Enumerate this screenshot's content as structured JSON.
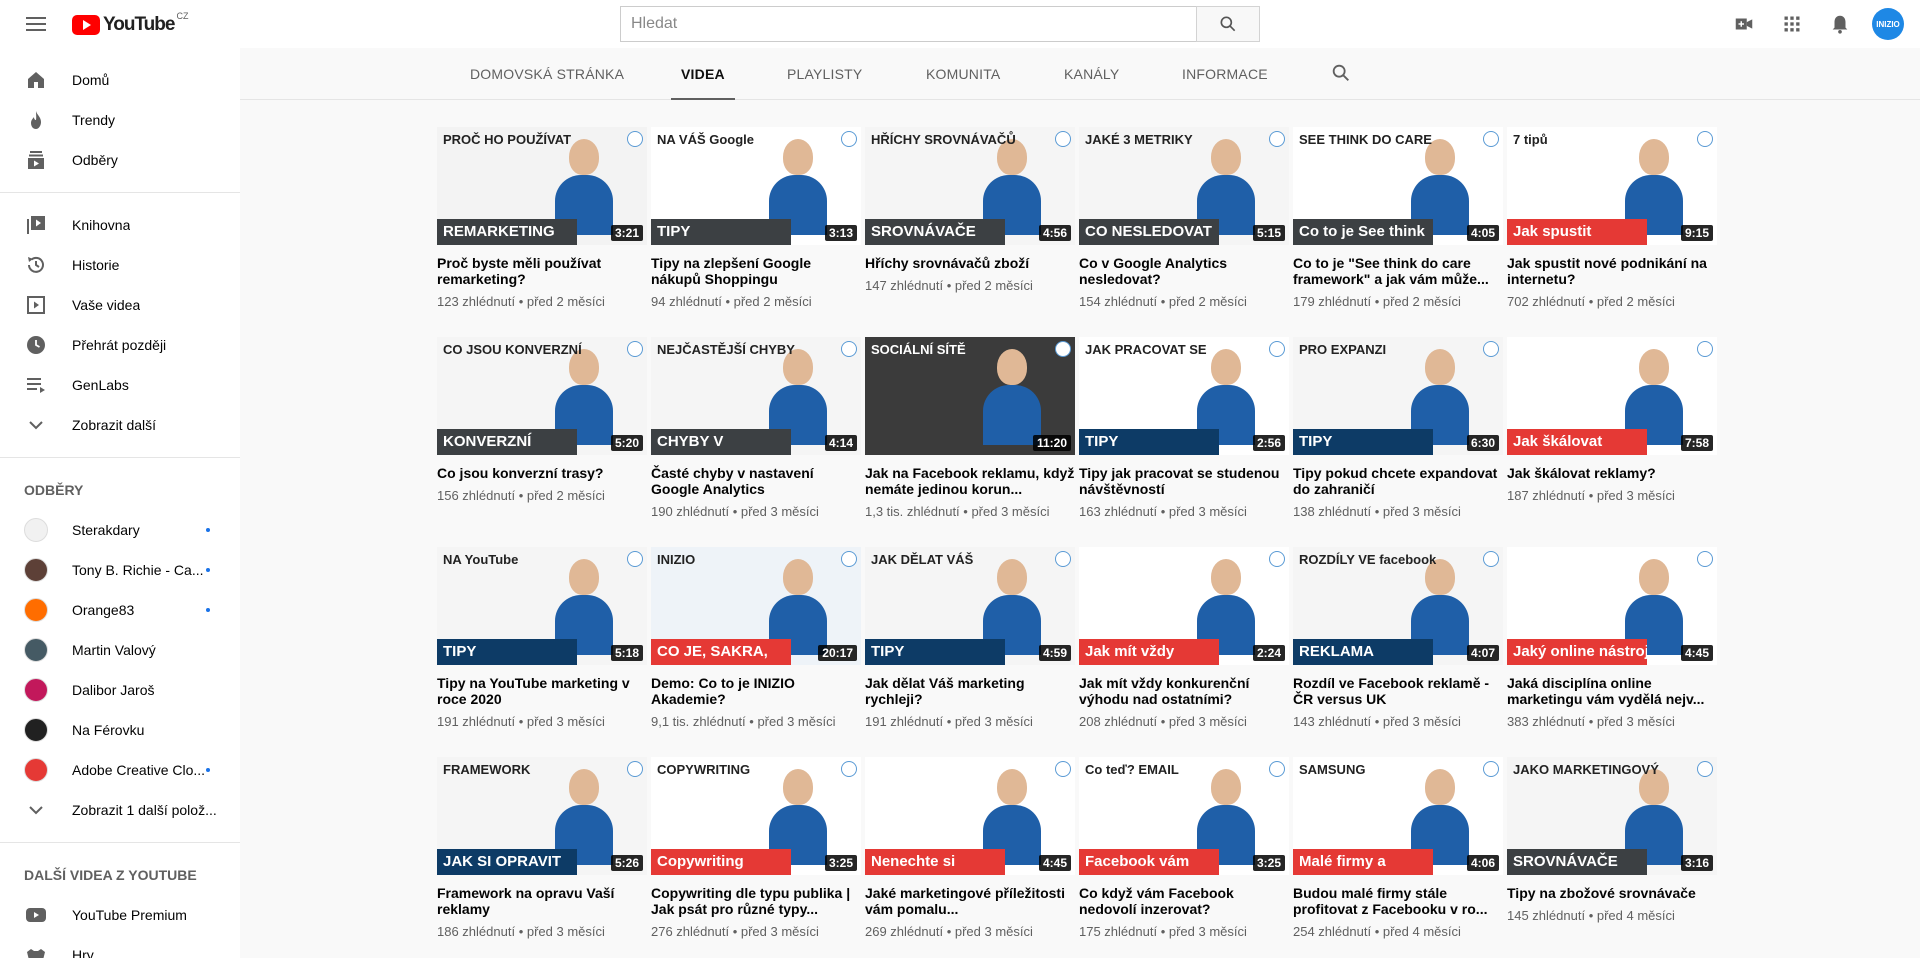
{
  "header": {
    "logo_text": "YouTube",
    "country_code": "CZ",
    "search_placeholder": "Hledat",
    "avatar_text": "INIZIO"
  },
  "sidebar": {
    "main": [
      {
        "label": "Domů",
        "icon": "home-icon"
      },
      {
        "label": "Trendy",
        "icon": "flame-icon"
      },
      {
        "label": "Odběry",
        "icon": "subscriptions-icon"
      }
    ],
    "library": [
      {
        "label": "Knihovna",
        "icon": "library-icon"
      },
      {
        "label": "Historie",
        "icon": "history-icon"
      },
      {
        "label": "Vaše videa",
        "icon": "your-videos-icon"
      },
      {
        "label": "Přehrát později",
        "icon": "watch-later-icon"
      },
      {
        "label": "GenLabs",
        "icon": "playlist-icon"
      },
      {
        "label": "Zobrazit další",
        "icon": "chevron-down-icon"
      }
    ],
    "subscriptions_heading": "ODBĚRY",
    "subscriptions": [
      {
        "label": "Sterakdary",
        "color": "#f1f1f1",
        "dot": true
      },
      {
        "label": "Tony B. Richie - Ca...",
        "color": "#5d4037",
        "dot": true
      },
      {
        "label": "Orange83",
        "color": "#ff6d00",
        "dot": true
      },
      {
        "label": "Martin Valový",
        "color": "#455a64",
        "dot": false
      },
      {
        "label": "Dalibor Jaroš",
        "color": "#c2185b",
        "dot": false
      },
      {
        "label": "Na Férovku",
        "color": "#212121",
        "dot": false
      },
      {
        "label": "Adobe Creative Clo...",
        "color": "#e53935",
        "dot": true
      }
    ],
    "show_more_subs": "Zobrazit 1 další polož...",
    "more_heading": "DALŠÍ VIDEA Z YOUTUBE",
    "more": [
      {
        "label": "YouTube Premium",
        "icon": "youtube-icon"
      },
      {
        "label": "Hry",
        "icon": "games-icon"
      }
    ]
  },
  "tabs": [
    {
      "label": "DOMOVSKÁ STRÁNKA",
      "active": false
    },
    {
      "label": "VIDEA",
      "active": true
    },
    {
      "label": "PLAYLISTY",
      "active": false
    },
    {
      "label": "KOMUNITA",
      "active": false
    },
    {
      "label": "KANÁLY",
      "active": false
    },
    {
      "label": "INFORMACE",
      "active": false
    }
  ],
  "colors": {
    "banner_dark": "#3c4043",
    "banner_red": "#e53935",
    "banner_blue": "#1565c0",
    "banner_navy": "#0d3b66",
    "accent": "#ff0000"
  },
  "videos": [
    {
      "title": "Proč byste měli používat remarketing?",
      "views": "123 zhlédnutí",
      "age": "před 2 měsíci",
      "duration": "3:21",
      "thumb_top": "PROČ HO POUŽÍVAT",
      "thumb_banner": "REMARKETING",
      "banner": "banner_dark",
      "bg": "#f3f3f3"
    },
    {
      "title": "Tipy na zlepšení Google nákupů Shoppingu",
      "views": "94 zhlédnutí",
      "age": "před 2 měsíci",
      "duration": "3:13",
      "thumb_top": "NA VÁŠ Google",
      "thumb_banner": "TIPY",
      "banner": "banner_dark",
      "bg": "#ffffff"
    },
    {
      "title": "Hříchy srovnávačů zboží",
      "views": "147 zhlédnutí",
      "age": "před 2 měsíci",
      "duration": "4:56",
      "thumb_top": "HŘÍCHY SROVNÁVAČŮ",
      "thumb_banner": "SROVNÁVAČE",
      "banner": "banner_dark",
      "bg": "#f5f5f5"
    },
    {
      "title": "Co v Google Analytics nesledovat?",
      "views": "154 zhlédnutí",
      "age": "před 2 měsíci",
      "duration": "5:15",
      "thumb_top": "JAKÉ 3 METRIKY",
      "thumb_banner": "CO NESLEDOVAT",
      "banner": "banner_dark",
      "bg": "#f5f5f5"
    },
    {
      "title": "Co to je \"See think do care framework\" a jak vám může...",
      "views": "179 zhlédnutí",
      "age": "před 2 měsíci",
      "duration": "4:05",
      "thumb_top": "SEE THINK DO CARE",
      "thumb_banner": "Co to je See think",
      "banner": "banner_dark",
      "bg": "#ffffff"
    },
    {
      "title": "Jak spustit nové podnikání na internetu?",
      "views": "702 zhlédnutí",
      "age": "před 2 měsíci",
      "duration": "9:15",
      "thumb_top": "7 tipů",
      "thumb_banner": "Jak spustit",
      "banner": "banner_red",
      "bg": "#ffffff"
    },
    {
      "title": "Co jsou konverzní trasy?",
      "views": "156 zhlédnutí",
      "age": "před 2 měsíci",
      "duration": "5:20",
      "thumb_top": "CO JSOU KONVERZNÍ",
      "thumb_banner": "KONVERZNÍ",
      "banner": "banner_dark",
      "bg": "#f5f5f5"
    },
    {
      "title": "Časté chyby v nastavení Google Analytics",
      "views": "190 zhlédnutí",
      "age": "před 3 měsíci",
      "duration": "4:14",
      "thumb_top": "NEJČASTĚJŠÍ CHYBY",
      "thumb_banner": "CHYBY V",
      "banner": "banner_dark",
      "bg": "#f5f5f5"
    },
    {
      "title": "Jak na Facebook reklamu, když nemáte jedinou korun...",
      "views": "1,3 tis. zhlédnutí",
      "age": "před 3 měsíci",
      "duration": "11:20",
      "thumb_top": "SOCIÁLNÍ SÍTĚ",
      "thumb_banner": "",
      "banner": "banner_dark",
      "bg": "#3b3b3b"
    },
    {
      "title": "Tipy jak pracovat se studenou návštěvností",
      "views": "163 zhlédnutí",
      "age": "před 3 měsíci",
      "duration": "2:56",
      "thumb_top": "JAK PRACOVAT SE",
      "thumb_banner": "TIPY",
      "banner": "banner_navy",
      "bg": "#ffffff"
    },
    {
      "title": "Tipy pokud chcete expandovat do zahraničí",
      "views": "138 zhlédnutí",
      "age": "před 3 měsíci",
      "duration": "6:30",
      "thumb_top": "PRO EXPANZI",
      "thumb_banner": "TIPY",
      "banner": "banner_navy",
      "bg": "#f5f5f5"
    },
    {
      "title": "Jak škálovat reklamy?",
      "views": "187 zhlédnutí",
      "age": "před 3 měsíci",
      "duration": "7:58",
      "thumb_top": "",
      "thumb_banner": "Jak škálovat",
      "banner": "banner_red",
      "bg": "#ffffff"
    },
    {
      "title": "Tipy na YouTube marketing v roce 2020",
      "views": "191 zhlédnutí",
      "age": "před 3 měsíci",
      "duration": "5:18",
      "thumb_top": "NA YouTube",
      "thumb_banner": "TIPY",
      "banner": "banner_navy",
      "bg": "#f5f5f5"
    },
    {
      "title": "Demo: Co to je INIZIO Akademie?",
      "views": "9,1 tis. zhlédnutí",
      "age": "před 3 měsíci",
      "duration": "20:17",
      "thumb_top": "INIZIO",
      "thumb_banner": "CO JE, SAKRA,",
      "banner": "banner_red",
      "bg": "#eef3f8"
    },
    {
      "title": "Jak dělat Váš marketing rychleji?",
      "views": "191 zhlédnutí",
      "age": "před 3 měsíci",
      "duration": "4:59",
      "thumb_top": "JAK DĚLAT VÁŠ",
      "thumb_banner": "TIPY",
      "banner": "banner_navy",
      "bg": "#f5f5f5"
    },
    {
      "title": "Jak mít vždy konkurenční výhodu nad ostatními?",
      "views": "208 zhlédnutí",
      "age": "před 3 měsíci",
      "duration": "2:24",
      "thumb_top": "",
      "thumb_banner": "Jak mít vždy",
      "banner": "banner_red",
      "bg": "#ffffff"
    },
    {
      "title": "Rozdíl ve Facebook reklamě - ČR versus UK",
      "views": "143 zhlédnutí",
      "age": "před 3 měsíci",
      "duration": "4:07",
      "thumb_top": "ROZDÍLY VE facebook",
      "thumb_banner": "REKLAMA",
      "banner": "banner_navy",
      "bg": "#f5f5f5"
    },
    {
      "title": "Jaká disciplína online marketingu vám vydělá nejv...",
      "views": "383 zhlédnutí",
      "age": "před 3 měsíci",
      "duration": "4:45",
      "thumb_top": "",
      "thumb_banner": "Jaký online nástroj",
      "banner": "banner_red",
      "bg": "#ffffff"
    },
    {
      "title": "Framework na opravu Vaší reklamy",
      "views": "186 zhlédnutí",
      "age": "před 3 měsíci",
      "duration": "5:26",
      "thumb_top": "FRAMEWORK",
      "thumb_banner": "JAK SI OPRAVIT",
      "banner": "banner_navy",
      "bg": "#f5f5f5"
    },
    {
      "title": "Copywriting dle typu publika | Jak psát pro různé typy...",
      "views": "276 zhlédnutí",
      "age": "před 3 měsíci",
      "duration": "3:25",
      "thumb_top": "COPYWRITING",
      "thumb_banner": "Copywriting",
      "banner": "banner_red",
      "bg": "#ffffff"
    },
    {
      "title": "Jaké marketingové příležitosti vám pomalu...",
      "views": "269 zhlédnutí",
      "age": "před 3 měsíci",
      "duration": "4:45",
      "thumb_top": "",
      "thumb_banner": "Nenechte si",
      "banner": "banner_red",
      "bg": "#ffffff"
    },
    {
      "title": "Co když vám Facebook nedovolí inzerovat?",
      "views": "175 zhlédnutí",
      "age": "před 3 měsíci",
      "duration": "3:25",
      "thumb_top": "Co teď? EMAIL",
      "thumb_banner": "Facebook vám",
      "banner": "banner_red",
      "bg": "#ffffff"
    },
    {
      "title": "Budou malé firmy stále profitovat z Facebooku v ro...",
      "views": "254 zhlédnutí",
      "age": "před 4 měsíci",
      "duration": "4:06",
      "thumb_top": "SAMSUNG",
      "thumb_banner": "Malé firmy a",
      "banner": "banner_red",
      "bg": "#ffffff"
    },
    {
      "title": "Tipy na zbožové srovnávače",
      "views": "145 zhlédnutí",
      "age": "před 4 měsíci",
      "duration": "3:16",
      "thumb_top": "JAKO MARKETINGOVÝ",
      "thumb_banner": "SROVNÁVAČE",
      "banner": "banner_dark",
      "bg": "#f5f5f5"
    }
  ]
}
